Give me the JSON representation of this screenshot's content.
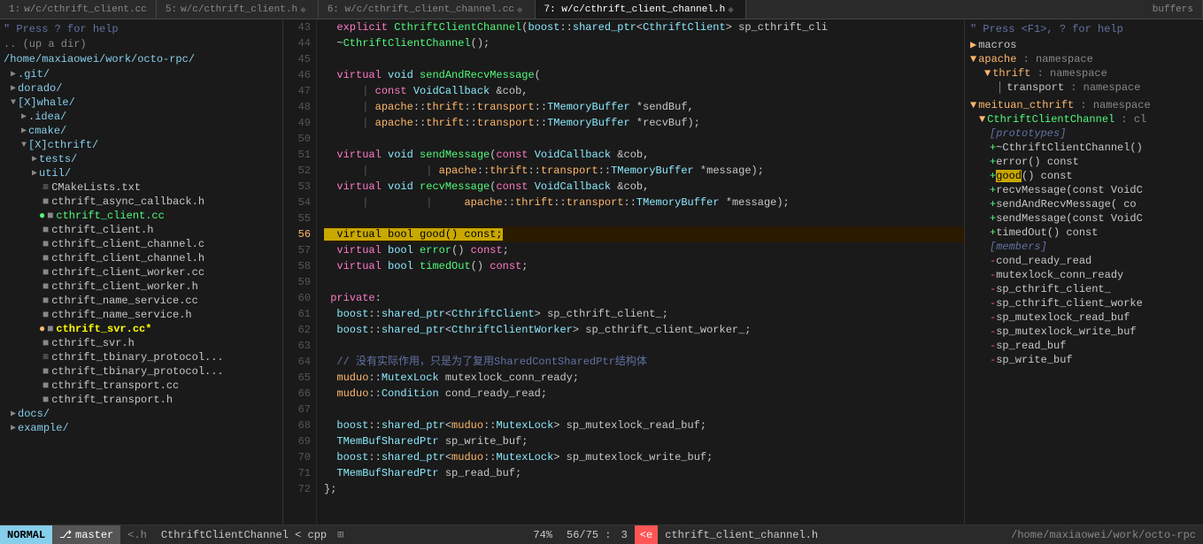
{
  "tabs": [
    {
      "id": 1,
      "label": "w/c/cthrift_client.cc",
      "active": false
    },
    {
      "id": 2,
      "label": "w/c/cthrift_client.h",
      "active": false
    },
    {
      "id": 3,
      "label": "6: w/c/cthrift_client_channel.cc",
      "active": false
    },
    {
      "id": 4,
      "label": "7: w/c/cthrift_client_channel.h",
      "active": true
    },
    {
      "id": 5,
      "label": "buffers",
      "active": false
    }
  ],
  "help_hint": "\" Press ? for help",
  "file_tree": {
    "hint": "\" Press ? for help",
    "up": ".. (up a dir)",
    "root_path": "/home/maxiaowei/work/octo-rpc/",
    "items": [
      {
        "type": "dir",
        "name": ".git/",
        "indent": 2,
        "expanded": false
      },
      {
        "type": "dir",
        "name": "dorado/",
        "indent": 2,
        "expanded": false
      },
      {
        "type": "dir",
        "name": "[X]whale/",
        "indent": 2,
        "expanded": true
      },
      {
        "type": "dir",
        "name": ".idea/",
        "indent": 4,
        "expanded": false
      },
      {
        "type": "dir",
        "name": "cmake/",
        "indent": 4,
        "expanded": false
      },
      {
        "type": "dir",
        "name": "[X]cthrift/",
        "indent": 4,
        "expanded": true
      },
      {
        "type": "dir",
        "name": "tests/",
        "indent": 6,
        "expanded": false
      },
      {
        "type": "dir",
        "name": "util/",
        "indent": 6,
        "expanded": false
      },
      {
        "type": "file",
        "name": "CMakeLists.txt",
        "indent": 8,
        "icon": "txt"
      },
      {
        "type": "file",
        "name": "cthrift_async_callback.h",
        "indent": 8,
        "icon": "h"
      },
      {
        "type": "file",
        "name": "cthrift_client.cc",
        "indent": 8,
        "icon": "c",
        "active": true
      },
      {
        "type": "file",
        "name": "cthrift_client.h",
        "indent": 8,
        "icon": "h"
      },
      {
        "type": "file",
        "name": "cthrift_client_channel.cc",
        "indent": 8,
        "icon": "c"
      },
      {
        "type": "file",
        "name": "cthrift_client_channel.h",
        "indent": 8,
        "icon": "h"
      },
      {
        "type": "file",
        "name": "cthrift_client_worker.cc",
        "indent": 8,
        "icon": "c"
      },
      {
        "type": "file",
        "name": "cthrift_client_worker.h",
        "indent": 8,
        "icon": "h"
      },
      {
        "type": "file",
        "name": "cthrift_name_service.cc",
        "indent": 8,
        "icon": "c"
      },
      {
        "type": "file",
        "name": "cthrift_name_service.h",
        "indent": 8,
        "icon": "h"
      },
      {
        "type": "file",
        "name": "cthrift_svr.cc*",
        "indent": 8,
        "icon": "c",
        "modified": true
      },
      {
        "type": "file",
        "name": "cthrift_svr.h",
        "indent": 8,
        "icon": "h"
      },
      {
        "type": "file",
        "name": "cthrift_tbinary_protocol...",
        "indent": 8,
        "icon": "c"
      },
      {
        "type": "file",
        "name": "cthrift_tbinary_protocol...",
        "indent": 8,
        "icon": "h"
      },
      {
        "type": "file",
        "name": "cthrift_transport.cc",
        "indent": 8,
        "icon": "c"
      },
      {
        "type": "file",
        "name": "cthrift_transport.h",
        "indent": 8,
        "icon": "h"
      },
      {
        "type": "dir",
        "name": "docs/",
        "indent": 2,
        "expanded": false
      },
      {
        "type": "dir",
        "name": "example/",
        "indent": 2,
        "expanded": false
      }
    ]
  },
  "code": {
    "lines": [
      {
        "num": 43,
        "text": "  explicit CthriftClientChannel(boost::shared_ptr<CthriftClient> sp_cthrift_cli"
      },
      {
        "num": 44,
        "text": "  ~CthriftClientChannel();"
      },
      {
        "num": 45,
        "text": ""
      },
      {
        "num": 46,
        "text": "  virtual void sendAndRecvMessage("
      },
      {
        "num": 47,
        "text": "      | const VoidCallback &cob,"
      },
      {
        "num": 48,
        "text": "      | apache::thrift::transport::TMemoryBuffer *sendBuf,"
      },
      {
        "num": 49,
        "text": "      | apache::thrift::transport::TMemoryBuffer *recvBuf);"
      },
      {
        "num": 50,
        "text": ""
      },
      {
        "num": 51,
        "text": "  virtual void sendMessage(const VoidCallback &cob,"
      },
      {
        "num": 52,
        "text": "      |         | apache::thrift::transport::TMemoryBuffer *message);"
      },
      {
        "num": 53,
        "text": "  virtual void recvMessage(const VoidCallback &cob,"
      },
      {
        "num": 54,
        "text": "      |         |     apache::thrift::transport::TMemoryBuffer *message);"
      },
      {
        "num": 55,
        "text": ""
      },
      {
        "num": 56,
        "text": "  virtual bool good() const;",
        "cursor": true
      },
      {
        "num": 57,
        "text": "  virtual bool error() const;"
      },
      {
        "num": 58,
        "text": "  virtual bool timedOut() const;"
      },
      {
        "num": 59,
        "text": ""
      },
      {
        "num": 60,
        "text": " private:"
      },
      {
        "num": 61,
        "text": "  boost::shared_ptr<CthriftClient> sp_cthrift_client_;"
      },
      {
        "num": 62,
        "text": "  boost::shared_ptr<CthriftClientWorker> sp_cthrift_client_worker_;"
      },
      {
        "num": 63,
        "text": ""
      },
      {
        "num": 64,
        "text": "  // 没有实际作用，只是为了复用SharedContSharedPtr结构体"
      },
      {
        "num": 65,
        "text": "  muduo::MutexLock mutexlock_conn_ready;"
      },
      {
        "num": 66,
        "text": "  muduo::Condition cond_ready_read;"
      },
      {
        "num": 67,
        "text": ""
      },
      {
        "num": 68,
        "text": "  boost::shared_ptr<muduo::MutexLock> sp_mutexlock_read_buf;"
      },
      {
        "num": 69,
        "text": "  TMemBufSharedPtr sp_write_buf;"
      },
      {
        "num": 70,
        "text": "  boost::shared_ptr<muduo::MutexLock> sp_mutexlock_write_buf;"
      },
      {
        "num": 71,
        "text": "  TMemBufSharedPtr sp_read_buf;"
      },
      {
        "num": 72,
        "text": "};"
      }
    ]
  },
  "right_panel": {
    "hint": "\" Press <F1>, ? for help",
    "sections": [
      {
        "label": "macros"
      },
      {
        "label": "apache",
        "type": "namespace",
        "keyword": "namespace",
        "expanded": true,
        "children": [
          {
            "label": "thrift",
            "type": "namespace",
            "keyword": "namespace",
            "indent": 2,
            "expanded": true,
            "children": [
              {
                "label": "transport",
                "type": "namespace",
                "keyword": "namespace",
                "indent": 4
              }
            ]
          }
        ]
      },
      {
        "label": "meituan_cthrift",
        "type": "namespace",
        "keyword": "namespace",
        "expanded": true,
        "children": [
          {
            "label": "CthriftClientChannel",
            "type": "class",
            "keyword": "cl",
            "indent": 2,
            "expanded": true,
            "children": [
              {
                "label": "[prototypes]",
                "type": "bracket",
                "indent": 4
              },
              {
                "label": "+~CthriftClientChannel()",
                "type": "member",
                "indent": 4
              },
              {
                "label": "+error() const",
                "type": "member",
                "indent": 4
              },
              {
                "label": "+good() const",
                "type": "member-hl",
                "indent": 4
              },
              {
                "label": "+recvMessage(const VoidC",
                "type": "member",
                "indent": 4
              },
              {
                "label": "+sendAndRecvMessage( co",
                "type": "member",
                "indent": 4
              },
              {
                "label": "+sendMessage(const VoidC",
                "type": "member",
                "indent": 4
              },
              {
                "label": "+timedOut() const",
                "type": "member",
                "indent": 4
              },
              {
                "label": "[members]",
                "type": "bracket",
                "indent": 4
              },
              {
                "label": "-cond_ready_read",
                "type": "member-minus",
                "indent": 4
              },
              {
                "label": "-mutexlock_conn_ready",
                "type": "member-minus",
                "indent": 4
              },
              {
                "label": "-sp_cthrift_client_",
                "type": "member-minus",
                "indent": 4
              },
              {
                "label": "-sp_cthrift_client_worke",
                "type": "member-minus",
                "indent": 4
              },
              {
                "label": "-sp_mutexlock_read_buf",
                "type": "member-minus",
                "indent": 4
              },
              {
                "label": "-sp_mutexlock_write_buf",
                "type": "member-minus",
                "indent": 4
              },
              {
                "label": "-sp_read_buf",
                "type": "member-minus",
                "indent": 4
              },
              {
                "label": "-sp_write_buf",
                "type": "member-minus",
                "indent": 4
              }
            ]
          }
        ]
      }
    ]
  },
  "status_bar": {
    "mode": "NORMAL",
    "branch": "master",
    "filetype": "<.h",
    "class": "CthriftClientChannel < cpp",
    "percent": "74%",
    "position": "56/75",
    "col": "3",
    "error_icon": "<e",
    "filename": "cthrift_client_channel.h"
  },
  "footer_path": "/home/maxiaowei/work/octo-rpc"
}
